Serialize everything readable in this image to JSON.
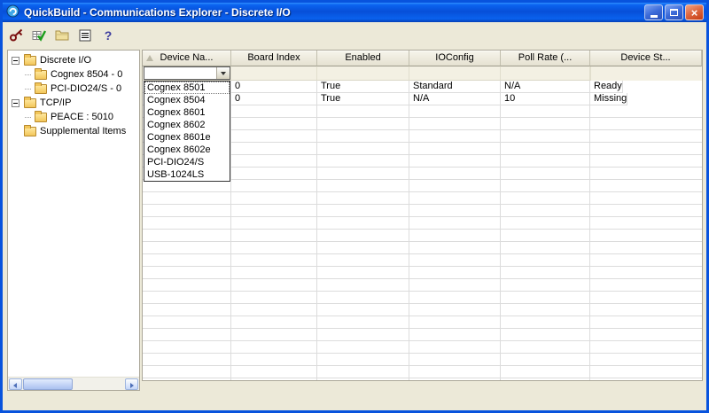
{
  "window": {
    "title": "QuickBuild - Communications Explorer - Discrete I/O"
  },
  "colors": {
    "titlebar_blue": "#0853DD",
    "window_face": "#ECE9D8",
    "grid_line": "#DCDCDC",
    "close_button_red": "#DE6A43"
  },
  "icons": {
    "close_glyph": "×",
    "help_glyph": "?"
  },
  "toolbar": {
    "buttons": [
      {
        "name": "connect-wizard"
      },
      {
        "name": "validate"
      },
      {
        "name": "open-folder"
      },
      {
        "name": "device-list"
      },
      {
        "name": "help"
      }
    ]
  },
  "tree": {
    "items": [
      {
        "label": "Discrete I/O",
        "level": 0,
        "expanded": true
      },
      {
        "label": "Cognex 8504 - 0",
        "level": 1
      },
      {
        "label": "PCI-DIO24/S - 0",
        "level": 1
      },
      {
        "label": "TCP/IP",
        "level": 0,
        "expanded": true
      },
      {
        "label": "PEACE : 5010",
        "level": 1
      },
      {
        "label": "Supplemental Items",
        "level": 0
      }
    ]
  },
  "grid": {
    "columns": [
      "Device Na...",
      "Board Index",
      "Enabled",
      "IOConfig",
      "Poll Rate (...",
      "Device St..."
    ],
    "rows": [
      {
        "device_name": "",
        "board_index": "0",
        "enabled": "True",
        "ioconfig": "Standard",
        "poll_rate": "N/A",
        "device_status": "Ready"
      },
      {
        "device_name": "",
        "board_index": "0",
        "enabled": "True",
        "ioconfig": "N/A",
        "poll_rate": "10",
        "device_status": "Missing"
      }
    ]
  },
  "combobox": {
    "value": "",
    "highlighted": "Cognex 8501",
    "options": [
      "Cognex 8501",
      "Cognex 8504",
      "Cognex 8601",
      "Cognex 8602",
      "Cognex 8601e",
      "Cognex 8602e",
      "PCI-DIO24/S",
      "USB-1024LS"
    ]
  }
}
